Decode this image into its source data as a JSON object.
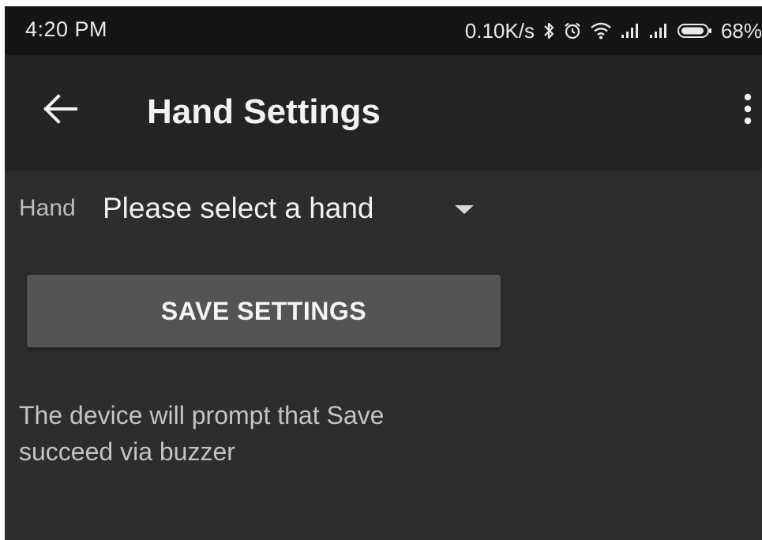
{
  "status_bar": {
    "time": "4:20 PM",
    "network_speed": "0.10K/s",
    "battery_percent": "68%",
    "icons": [
      "bluetooth-icon",
      "alarm-icon",
      "wifi-icon",
      "signal-icon",
      "signal-icon",
      "battery-icon"
    ]
  },
  "app_bar": {
    "title": "Hand Settings",
    "back_icon": "back-arrow-icon",
    "menu_icon": "more-vert-icon"
  },
  "hand_setting": {
    "label": "Hand",
    "selected_value": "Please select a hand"
  },
  "save_button": {
    "label": "SAVE SETTINGS"
  },
  "info": {
    "text": "The device will prompt that Save succeed via buzzer"
  },
  "colors": {
    "status_bar_bg": "#151515",
    "app_bar_bg": "#242424",
    "content_bg": "#2d2d2d",
    "button_bg": "#545454",
    "text_primary": "#f2f2f2",
    "text_secondary": "#bdbdbd"
  }
}
